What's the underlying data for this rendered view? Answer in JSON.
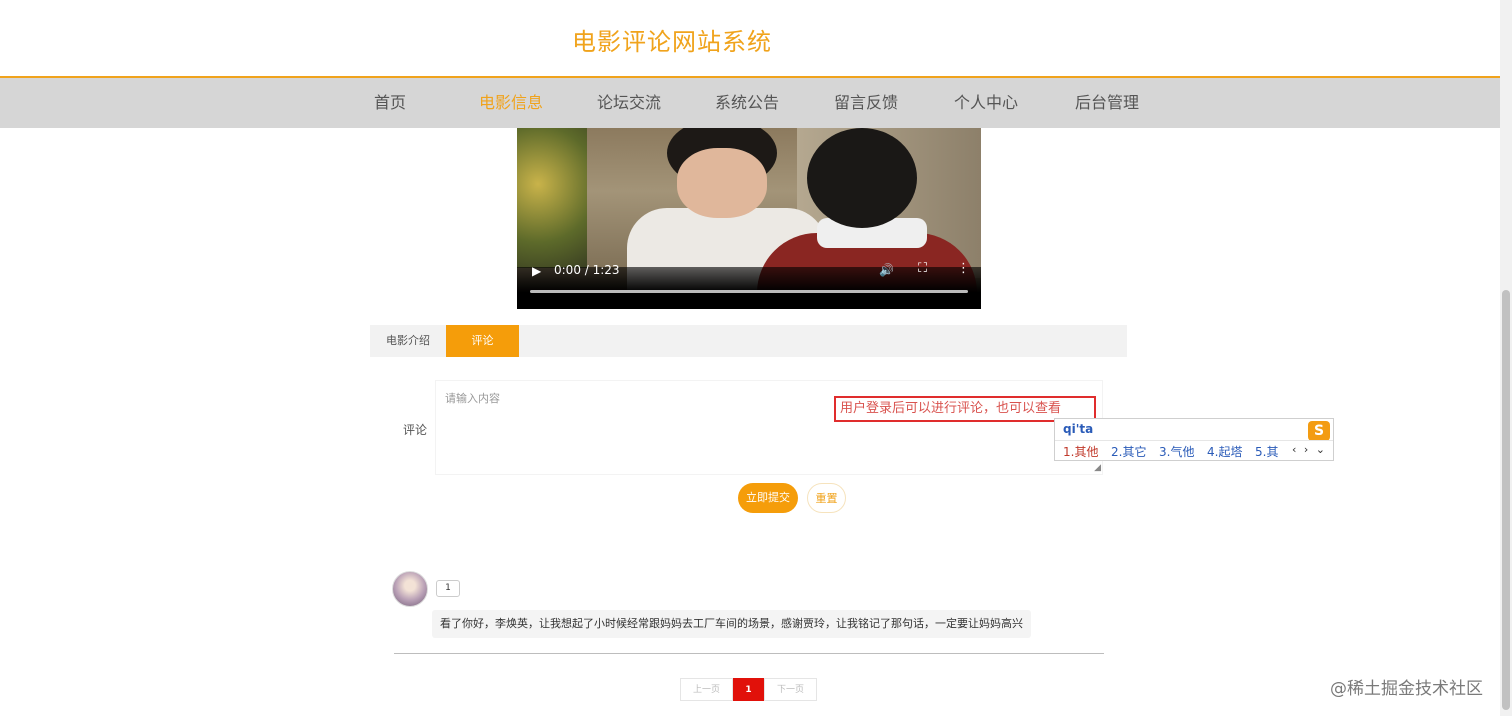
{
  "header": {
    "site_title": "电影评论网站系统"
  },
  "nav": {
    "items": [
      "首页",
      "电影信息",
      "论坛交流",
      "系统公告",
      "留言反馈",
      "个人中心",
      "后台管理"
    ],
    "active": "电影信息"
  },
  "video": {
    "time": "0:00 / 1:23",
    "progress_fraction": 0.0
  },
  "tabs": {
    "intro": "电影介绍",
    "comment": "评论",
    "active": "评论"
  },
  "comment_form": {
    "label": "评论",
    "placeholder": "请输入内容",
    "tooltip": "用户登录后可以进行评论，也可以查看",
    "submit_label": "立即提交",
    "reset_label": "重置"
  },
  "ime": {
    "pinyin": "qi'ta",
    "logo": "S",
    "candidates": [
      "1.其他",
      "2.其它",
      "3.气他",
      "4.起塔",
      "5.其"
    ],
    "arrows": "‹ › ⌄"
  },
  "comments": [
    {
      "badge": "1",
      "text": "看了你好，李焕英，让我想起了小时候经常跟妈妈去工厂车间的场景，感谢贾玲，让我铭记了那句话，一定要让妈妈高兴"
    }
  ],
  "pagination": {
    "prev": "上一页",
    "current": "1",
    "next": "下一页"
  },
  "watermark": "@稀土掘金技术社区",
  "colors": {
    "accent": "#f0a31c",
    "button": "#f59d0a",
    "pager_active": "#e1110a",
    "tooltip_border": "#e02d2d"
  },
  "icons": {
    "play": "play-icon",
    "volume": "volume-icon",
    "fullscreen": "fullscreen-icon",
    "more": "more-vert-icon"
  }
}
